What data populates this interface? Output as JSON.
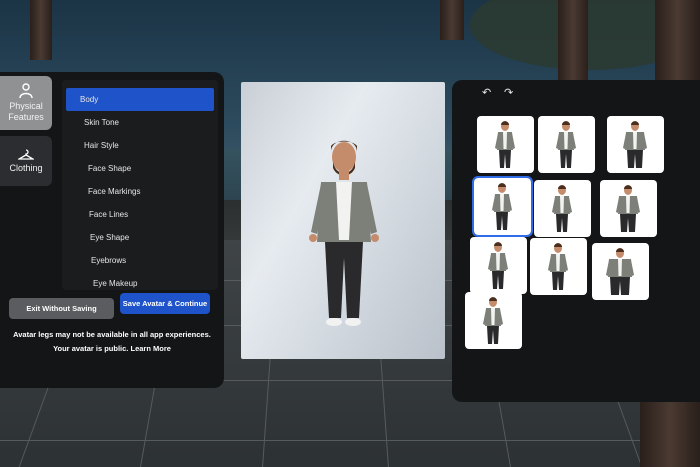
{
  "left_panel": {
    "tabs": [
      {
        "label": "Physical Features",
        "icon": "person-icon",
        "active": true
      },
      {
        "label": "Clothing",
        "icon": "hanger-icon",
        "active": false
      }
    ],
    "menu": [
      {
        "label": "Body",
        "active": true
      },
      {
        "label": "Skin Tone"
      },
      {
        "label": "Hair Style"
      },
      {
        "label": "Face Shape"
      },
      {
        "label": "Face Markings"
      },
      {
        "label": "Face Lines"
      },
      {
        "label": "Eye Shape"
      },
      {
        "label": "Eyebrows"
      },
      {
        "label": "Eye Makeup"
      }
    ],
    "exit_label": "Exit Without Saving",
    "save_label": "Save Avatar & Continue",
    "legs_note": "Avatar legs may not be available in all app experiences.",
    "public_note": "Your avatar is public.",
    "learn_more": "Learn More"
  },
  "right_panel": {
    "undo_icon": "undo-icon",
    "redo_icon": "redo-icon",
    "options": [
      {
        "body_type": "slim"
      },
      {
        "body_type": "slim"
      },
      {
        "body_type": "medium"
      },
      {
        "body_type": "slim",
        "selected": true
      },
      {
        "body_type": "slim"
      },
      {
        "body_type": "medium"
      },
      {
        "body_type": "slim"
      },
      {
        "body_type": "slim"
      },
      {
        "body_type": "broad"
      },
      {
        "body_type": "slim"
      }
    ]
  },
  "colors": {
    "accent": "#1f53c9",
    "panel_bg": "#141517",
    "selected_outline": "#2f6de8"
  }
}
